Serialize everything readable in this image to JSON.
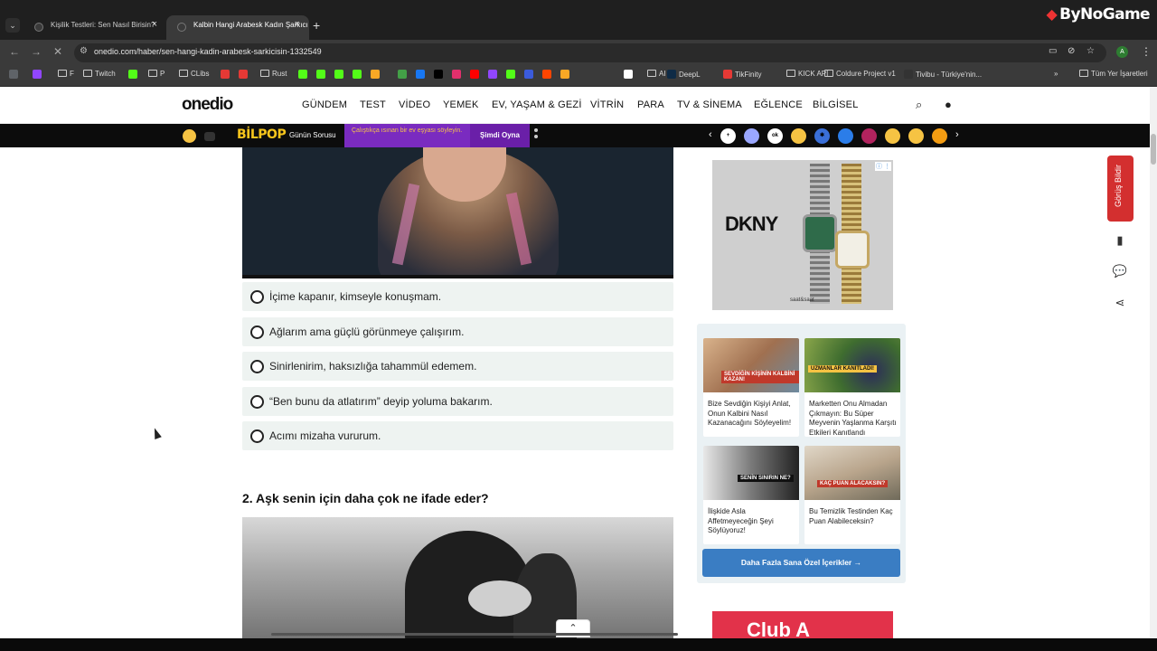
{
  "browser": {
    "tabs": [
      {
        "title": "Kişilik Testleri: Sen Nasıl Birisin?",
        "close": "×"
      },
      {
        "title": "Kalbin Hangi Arabesk Kadın Şarkıcı",
        "close": "×"
      }
    ],
    "new_tab": "+",
    "tab_menu": "⌄",
    "url": "onedio.com/haber/sen-hangi-kadin-arabesk-sarkicisin-1332549",
    "profile_initial": "A",
    "overlay_brand": "ByNoGame"
  },
  "bookmarks": [
    {
      "label": "",
      "type": "app",
      "color": "#5f6368"
    },
    {
      "label": "",
      "type": "favicon",
      "color": "#9146ff"
    },
    {
      "label": "F",
      "type": "folder"
    },
    {
      "label": "Twitch",
      "type": "folder"
    },
    {
      "label": "",
      "type": "favicon",
      "color": "#53fc18"
    },
    {
      "label": "P",
      "type": "folder"
    },
    {
      "label": "CLibs",
      "type": "folder"
    },
    {
      "label": "",
      "type": "favicon",
      "color": "#e53935"
    },
    {
      "label": "",
      "type": "favicon",
      "color": "#e53935"
    },
    {
      "label": "Rust",
      "type": "folder"
    },
    {
      "label": "",
      "type": "favicon",
      "color": "#53fc18"
    },
    {
      "label": "",
      "type": "favicon",
      "color": "#53fc18"
    },
    {
      "label": "",
      "type": "favicon",
      "color": "#53fc18"
    },
    {
      "label": "",
      "type": "favicon",
      "color": "#53fc18"
    },
    {
      "label": "",
      "type": "favicon",
      "color": "#f9a825"
    },
    {
      "label": "",
      "type": "favicon",
      "color": "#43a047"
    },
    {
      "label": "",
      "type": "favicon",
      "color": "#1877f2"
    },
    {
      "label": "",
      "type": "favicon",
      "color": "#000000"
    },
    {
      "label": "",
      "type": "favicon",
      "color": "#e1306c"
    },
    {
      "label": "",
      "type": "favicon",
      "color": "#ff0000"
    },
    {
      "label": "",
      "type": "favicon",
      "color": "#9146ff"
    },
    {
      "label": "",
      "type": "favicon",
      "color": "#53fc18"
    },
    {
      "label": "",
      "type": "favicon",
      "color": "#3b5bdb"
    },
    {
      "label": "",
      "type": "favicon",
      "color": "#ff4500"
    },
    {
      "label": "",
      "type": "favicon",
      "color": "#f9a825"
    },
    {
      "label": "",
      "type": "favicon",
      "color": "#ffffff"
    },
    {
      "label": "AI",
      "type": "folder"
    },
    {
      "label": "DeepL",
      "type": "favicon",
      "color": "#0f2b46"
    },
    {
      "label": "TikFinity",
      "type": "favicon",
      "color": "#e53935"
    },
    {
      "label": "KICK API",
      "type": "folder"
    },
    {
      "label": "Coldure Project v1",
      "type": "folder"
    },
    {
      "label": "Tivibu - Türkiye'nin...",
      "type": "favicon",
      "color": "#333333"
    }
  ],
  "bookmarks_more": "»",
  "bookmarks_all": "Tüm Yer İşaretleri",
  "site": {
    "logo": "onedio",
    "nav": [
      "GÜNDEM",
      "TEST",
      "VİDEO",
      "YEMEK",
      "EV, YAŞAM & GEZİ",
      "VİTRİN",
      "PARA",
      "TV & SİNEMA",
      "EĞLENCE",
      "BİLGİSEL"
    ],
    "strip": {
      "brand": "BİLPOP",
      "daily": "Günün Sorusu",
      "question": "Çalıştıkça ısınan bir ev eşyası söyleyin.",
      "play": "Şimdi Oyna",
      "channels": [
        {
          "label": "+",
          "color": "#ffffff"
        },
        {
          "label": "",
          "color": "#9aa7ff"
        },
        {
          "label": "ok",
          "color": "#ffffff"
        },
        {
          "label": "",
          "color": "#f6c343"
        },
        {
          "label": "✱",
          "color": "#3a6fd8"
        },
        {
          "label": "",
          "color": "#2b7de9"
        },
        {
          "label": "",
          "color": "#b2235e"
        },
        {
          "label": "",
          "color": "#f6c343"
        },
        {
          "label": "",
          "color": "#f6c343"
        },
        {
          "label": "",
          "color": "#f39c12"
        }
      ]
    },
    "question1_options": [
      "İçime kapanır, kimseyle konuşmam.",
      "Ağlarım ama güçlü görünmeye çalışırım.",
      "Sinirlenirim, haksızlığa tahammül edemem.",
      "“Ben bunu da atlatırım” deyip yoluma bakarım.",
      "Acımı mizaha vururum."
    ],
    "question2_title": "2. Aşk senin için daha çok ne ifade eder?",
    "ad_top": {
      "brand": "DKNY",
      "sub": "saat&saat"
    },
    "recommended": [
      {
        "caption": "Bize Sevdiğin Kişiyi Anlat, Onun Kalbini Nasıl Kazanacağını Söyleyelim!",
        "label": "SEVDİĞİN KİŞİNİN KALBİNİ KAZAN!"
      },
      {
        "caption": "Marketten Onu Almadan Çıkmayın: Bu Süper Meyvenin Yaşlanma Karşıtı Etkileri Kanıtlandı",
        "label": "UZMANLAR KANITLADI!"
      },
      {
        "caption": "İlişkide Asla Affetmeyeceğin Şeyi Söylüyoruz!",
        "label": "SENİN SINIRIN NE?"
      },
      {
        "caption": "Bu Temizlik Testinden Kaç Puan Alabileceksin?",
        "label": "KAÇ PUAN ALACAKSIN?"
      }
    ],
    "more_button": "Daha Fazla Sana Özel İçerikler →",
    "ad_bottom": "Club A",
    "feedback": "Görüş Bildir"
  }
}
